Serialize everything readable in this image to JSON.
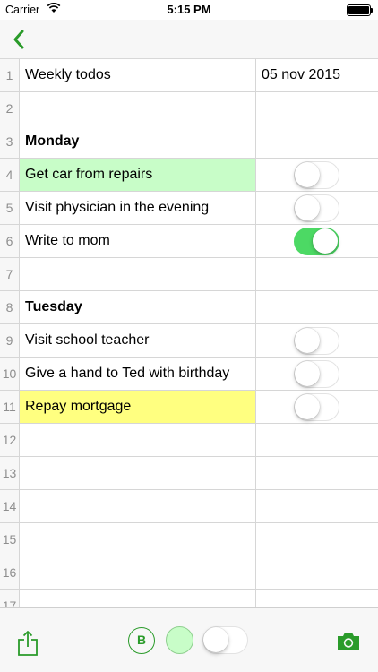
{
  "statusbar": {
    "carrier": "Carrier",
    "time": "5:15 PM"
  },
  "navbar": {
    "back_icon": "chevron-left-icon"
  },
  "colors": {
    "accent": "#2a9b2a",
    "highlight_green": "#c8fdc8",
    "highlight_yellow": "#ffff80",
    "toggle_on": "#4cd964"
  },
  "rows": [
    {
      "num": "1",
      "a": "Weekly todos",
      "b": "05 nov 2015"
    },
    {
      "num": "2",
      "a": "",
      "b": ""
    },
    {
      "num": "3",
      "a": "Monday",
      "b": ""
    },
    {
      "num": "4",
      "a": "Get car from repairs",
      "b": ""
    },
    {
      "num": "5",
      "a": "Visit physician in the evening",
      "b": ""
    },
    {
      "num": "6",
      "a": "Write to mom",
      "b": ""
    },
    {
      "num": "7",
      "a": "",
      "b": ""
    },
    {
      "num": "8",
      "a": "Tuesday",
      "b": ""
    },
    {
      "num": "9",
      "a": "Visit school teacher",
      "b": ""
    },
    {
      "num": "10",
      "a": "Give a hand to Ted with birthday",
      "b": ""
    },
    {
      "num": "11",
      "a": "Repay mortgage",
      "b": ""
    },
    {
      "num": "12",
      "a": "",
      "b": ""
    },
    {
      "num": "13",
      "a": "",
      "b": ""
    },
    {
      "num": "14",
      "a": "",
      "b": ""
    },
    {
      "num": "15",
      "a": "",
      "b": ""
    },
    {
      "num": "16",
      "a": "",
      "b": ""
    },
    {
      "num": "17",
      "a": "",
      "b": ""
    }
  ],
  "toolbar": {
    "bold_label": "B"
  }
}
